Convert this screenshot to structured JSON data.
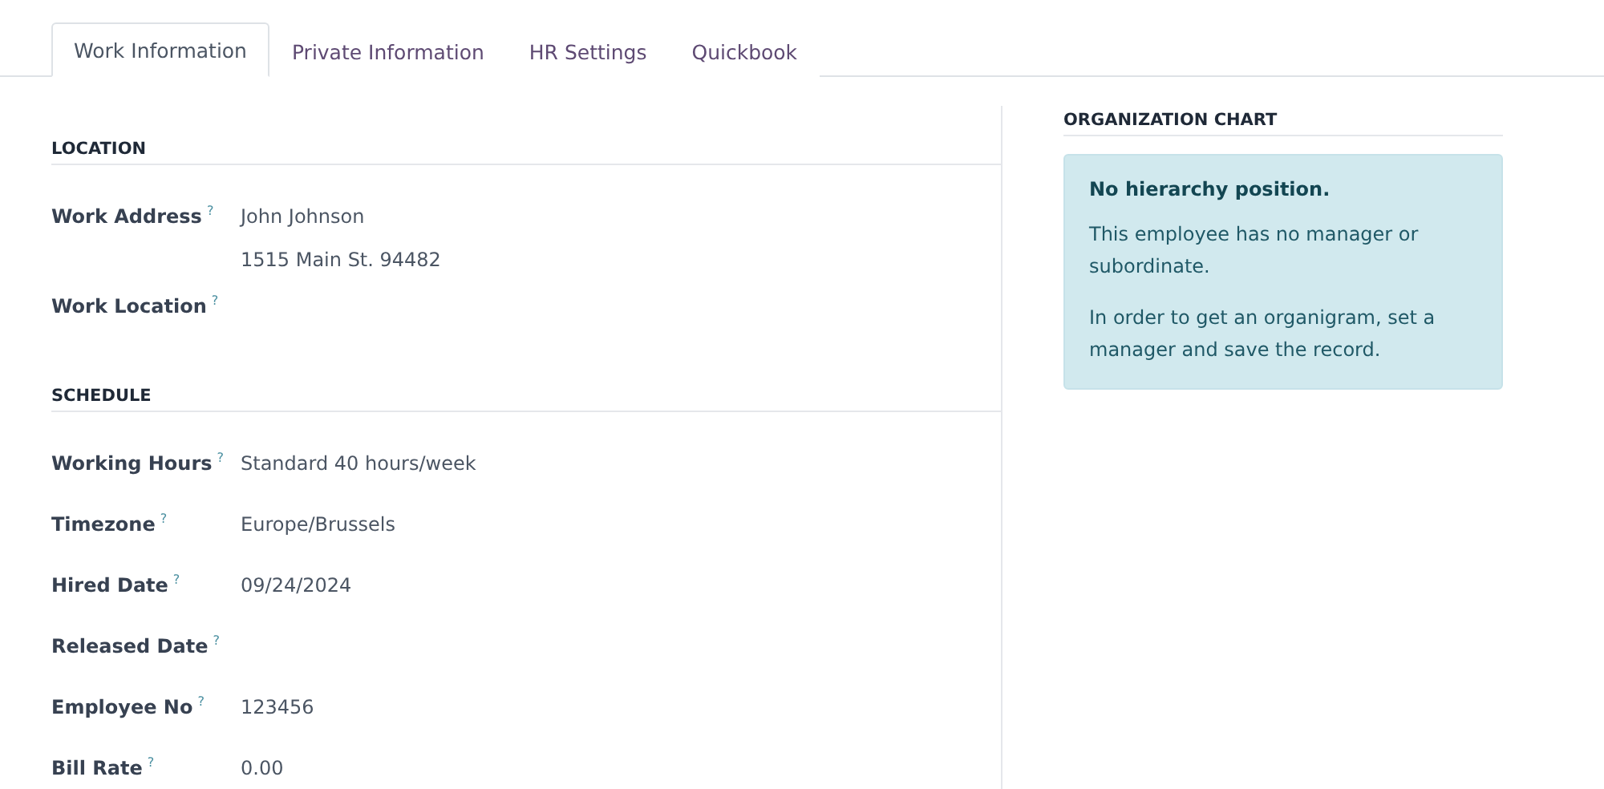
{
  "tabs": [
    {
      "label": "Work Information",
      "selected": true
    },
    {
      "label": "Private Information",
      "selected": false
    },
    {
      "label": "HR Settings",
      "selected": false
    },
    {
      "label": "Quickbook",
      "selected": false
    }
  ],
  "sections": [
    {
      "title": "LOCATION",
      "fields": [
        {
          "label": "Work Address",
          "help": "?",
          "lines": [
            "John Johnson",
            "1515 Main St. 94482"
          ]
        },
        {
          "label": "Work Location",
          "help": "?"
        }
      ]
    },
    {
      "title": "SCHEDULE",
      "fields": [
        {
          "label": "Working Hours",
          "help": "?",
          "lines": [
            "Standard 40 hours/week"
          ]
        },
        {
          "label": "Timezone",
          "help": "?",
          "lines": [
            "Europe/Brussels"
          ]
        },
        {
          "label": "Hired Date",
          "help": "?",
          "lines": [
            "09/24/2024"
          ]
        },
        {
          "label": "Released Date",
          "help": "?"
        },
        {
          "label": "Employee No",
          "help": "?",
          "lines": [
            "123456"
          ]
        },
        {
          "label": "Bill Rate",
          "help": "?",
          "lines": [
            "0.00"
          ]
        }
      ]
    }
  ],
  "org_chart": {
    "title": "ORGANIZATION CHART",
    "alert_title": "No hierarchy position.",
    "paragraphs": [
      "This employee has no manager or subordinate.",
      "In order to get an organigram, set a manager and save the record."
    ]
  }
}
